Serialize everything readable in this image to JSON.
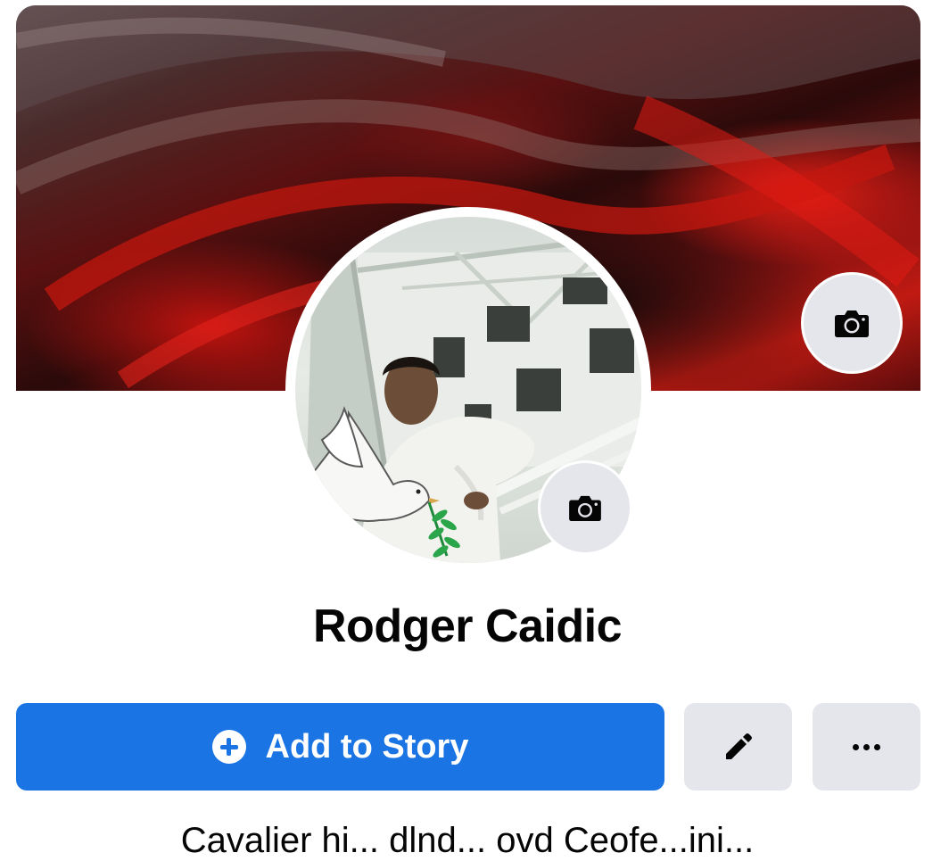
{
  "profile": {
    "name": "Rodger Caidic",
    "bio_partial": "Cavalier hi... dlnd... ovd Ceofe...ini..."
  },
  "actions": {
    "add_story_label": "Add to Story",
    "add_story_icon": "plus-circle-icon",
    "edit_icon": "pencil-icon",
    "more_icon": "ellipsis-icon"
  },
  "cover": {
    "edit_icon": "camera-icon"
  },
  "avatar": {
    "edit_icon": "camera-icon"
  },
  "colors": {
    "primary_button": "#1b74e4",
    "secondary_button": "#e4e6eb",
    "text": "#050505"
  }
}
